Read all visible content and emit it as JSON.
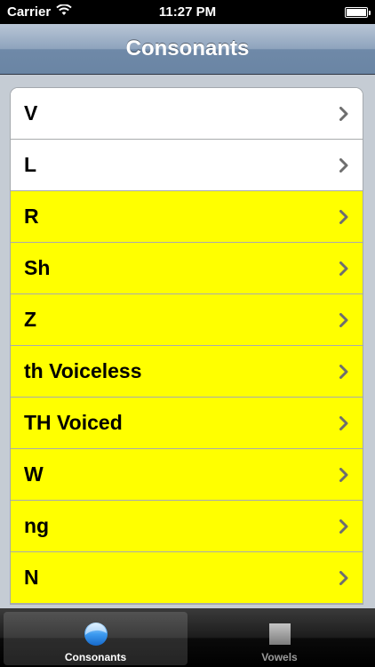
{
  "status_bar": {
    "carrier": "Carrier",
    "time": "11:27 PM"
  },
  "nav": {
    "title": "Consonants"
  },
  "colors": {
    "highlight": "#ffff00",
    "plain": "#ffffff"
  },
  "rows": [
    {
      "label": "V",
      "highlighted": false
    },
    {
      "label": "L",
      "highlighted": false
    },
    {
      "label": "R",
      "highlighted": true
    },
    {
      "label": "Sh",
      "highlighted": true
    },
    {
      "label": "Z",
      "highlighted": true
    },
    {
      "label": "th Voiceless",
      "highlighted": true
    },
    {
      "label": "TH Voiced",
      "highlighted": true
    },
    {
      "label": "W",
      "highlighted": true
    },
    {
      "label": "ng",
      "highlighted": true
    },
    {
      "label": "N",
      "highlighted": true
    }
  ],
  "tabs": [
    {
      "label": "Consonants",
      "icon": "circle-icon",
      "active": true
    },
    {
      "label": "Vowels",
      "icon": "square-icon",
      "active": false
    }
  ]
}
